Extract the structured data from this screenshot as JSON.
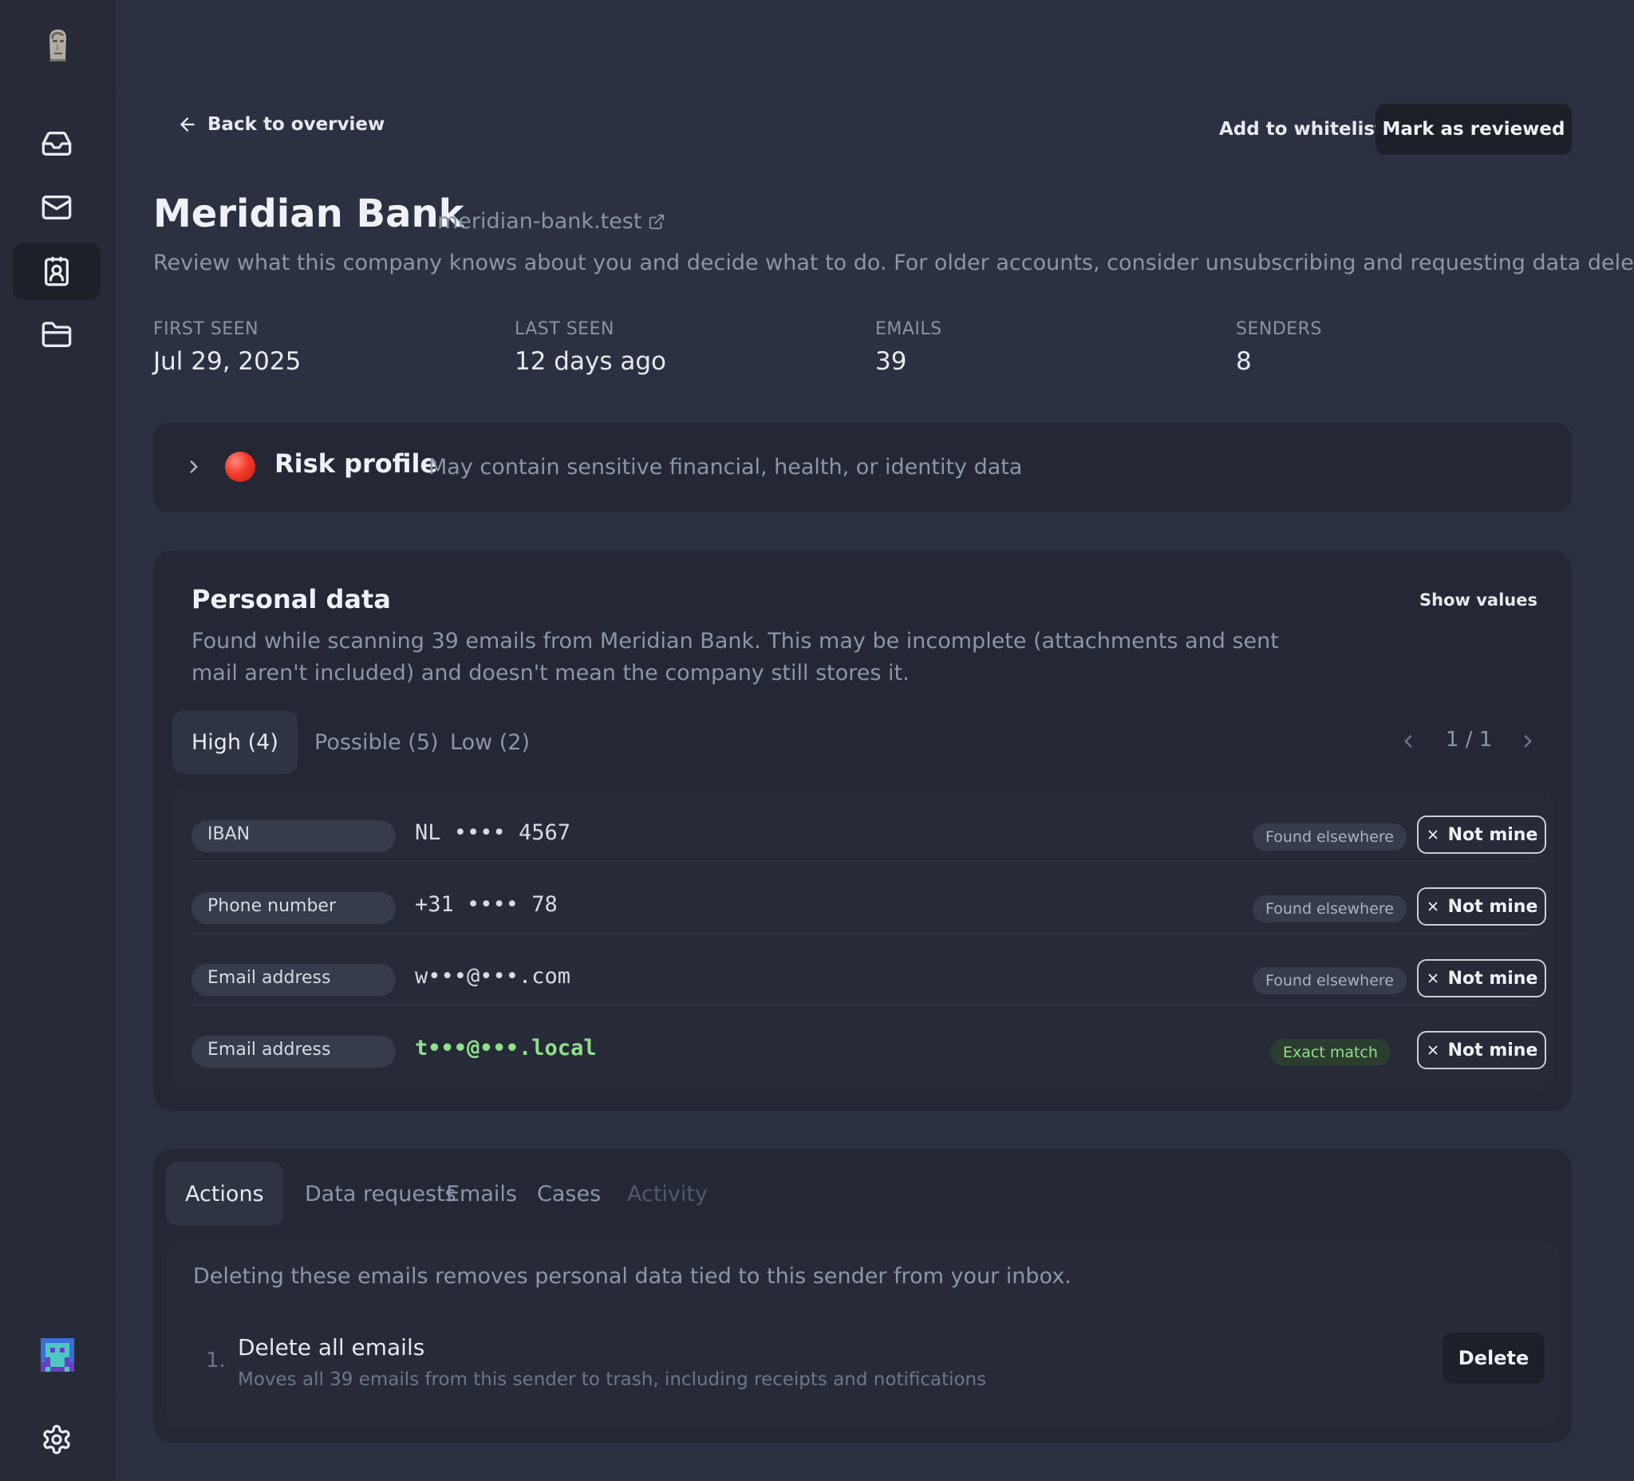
{
  "nav": {
    "logo_icon": "moai-icon",
    "items": [
      {
        "icon": "inbox-icon",
        "active": false
      },
      {
        "icon": "mail-icon",
        "active": false
      },
      {
        "icon": "contact-icon",
        "active": true
      },
      {
        "icon": "folder-icon",
        "active": false
      }
    ],
    "avatar_icon": "avatar",
    "settings_icon": "gear-icon"
  },
  "header": {
    "back_label": "Back to overview",
    "whitelist_label": "Add to whitelist",
    "reviewed_label": "Mark as reviewed"
  },
  "company": {
    "name": "Meridian Bank",
    "domain": "meridian-bank.test",
    "description": "Review what this company knows about you and decide what to do. For older accounts, consider unsubscribing and requesting data deletion."
  },
  "stats": [
    {
      "label": "FIRST SEEN",
      "value": "Jul 29, 2025"
    },
    {
      "label": "LAST SEEN",
      "value": "12 days ago"
    },
    {
      "label": "EMAILS",
      "value": "39"
    },
    {
      "label": "SENDERS",
      "value": "8"
    }
  ],
  "risk": {
    "title": "Risk profile",
    "description": "May contain sensitive financial, health, or identity data",
    "status_color": "#e53228"
  },
  "personal_data": {
    "title": "Personal data",
    "show_values_label": "Show values",
    "description": "Found while scanning 39 emails from Meridian Bank. This may be incomplete (attachments and sent mail aren't included) and doesn't mean the company still stores it.",
    "tabs": [
      "High (4)",
      "Possible (5)",
      "Low (2)"
    ],
    "active_tab": 0,
    "pager": "1 / 1",
    "items": [
      {
        "type": "IBAN",
        "value": "NL •••• 4567",
        "badge": "Found elsewhere",
        "action": "Not mine"
      },
      {
        "type": "Phone number",
        "value": "+31 •••• 78",
        "badge": "Found elsewhere",
        "action": "Not mine"
      },
      {
        "type": "Email address",
        "value": "w•••@•••.com",
        "badge": "Found elsewhere",
        "action": "Not mine"
      },
      {
        "type": "Email address",
        "value": "t•••@•••.local",
        "badge": "Exact match",
        "action": "Not mine"
      }
    ]
  },
  "actions": {
    "tabs": [
      "Actions",
      "Data requests",
      "Emails",
      "Cases",
      "Activity"
    ],
    "active_tab": 0,
    "description": "Deleting these emails removes personal data tied to this sender from your inbox.",
    "steps": [
      {
        "number": "1.",
        "title": "Delete all emails",
        "subtitle": "Moves all 39 emails from this sender to trash, including receipts and notifications",
        "button": "Delete"
      }
    ]
  },
  "colors": {
    "background": "#2b3140",
    "card": "#232834",
    "match_green": "#8fe08a"
  }
}
